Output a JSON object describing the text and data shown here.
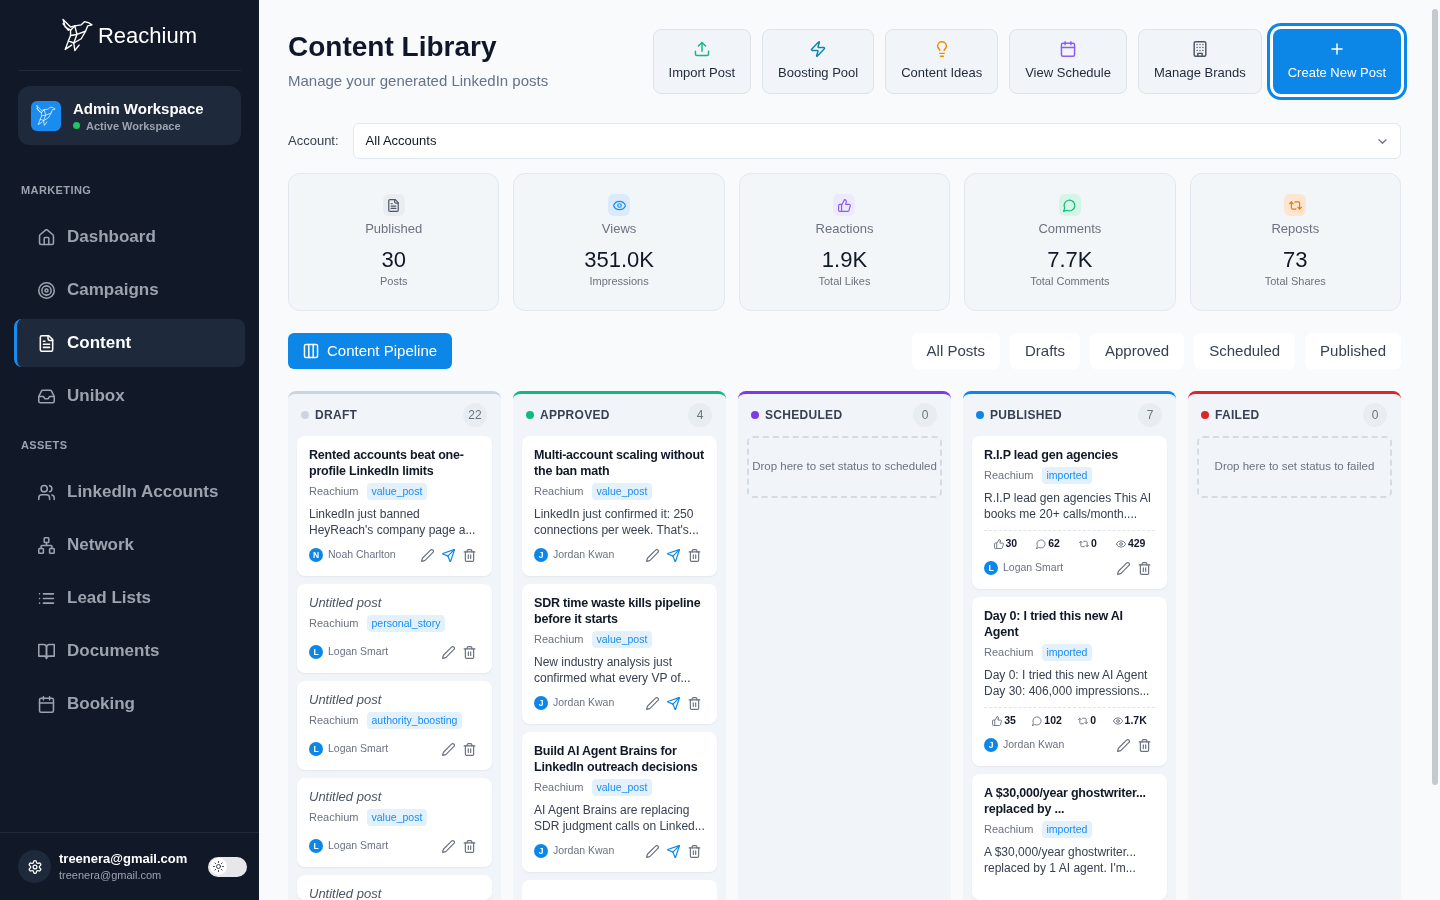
{
  "sidebar": {
    "brand": "Reachium",
    "workspace": {
      "name": "Admin Workspace",
      "status": "Active Workspace"
    },
    "sections": [
      {
        "title": "MARKETING",
        "items": [
          {
            "label": "Dashboard",
            "kind": "home",
            "selected": false
          },
          {
            "label": "Campaigns",
            "kind": "target",
            "selected": false
          },
          {
            "label": "Content",
            "kind": "document",
            "selected": true
          },
          {
            "label": "Unibox",
            "kind": "inbox",
            "selected": false
          }
        ]
      },
      {
        "title": "ASSETS",
        "items": [
          {
            "label": "LinkedIn Accounts",
            "kind": "users",
            "selected": false
          },
          {
            "label": "Network",
            "kind": "network",
            "selected": false
          },
          {
            "label": "Lead Lists",
            "kind": "list",
            "selected": false
          },
          {
            "label": "Documents",
            "kind": "book",
            "selected": false
          },
          {
            "label": "Booking",
            "kind": "calendar",
            "selected": false
          }
        ]
      }
    ],
    "user": {
      "name": "treenera@gmail.com",
      "email": "treenera@gmail.com"
    },
    "theme_toggle": {
      "dark_mode": false
    }
  },
  "header": {
    "title": "Content Library",
    "subtitle": "Manage your generated LinkedIn posts",
    "actions": [
      {
        "label": "Import Post",
        "kind": "upload",
        "primary": false
      },
      {
        "label": "Boosting Pool",
        "kind": "zap",
        "primary": false
      },
      {
        "label": "Content Ideas",
        "kind": "bulb",
        "primary": false
      },
      {
        "label": "View Schedule",
        "kind": "calendar",
        "primary": false
      },
      {
        "label": "Manage Brands",
        "kind": "building",
        "primary": false
      },
      {
        "label": "Create New Post",
        "kind": "plus",
        "primary": true
      }
    ]
  },
  "account_filter": {
    "label": "Account:",
    "value": "All Accounts"
  },
  "stats": [
    {
      "kind": "document",
      "label": "Published",
      "value": "30",
      "caption": "Posts"
    },
    {
      "kind": "eye",
      "label": "Views",
      "value": "351.0K",
      "caption": "Impressions"
    },
    {
      "kind": "thumb",
      "label": "Reactions",
      "value": "1.9K",
      "caption": "Total Likes"
    },
    {
      "kind": "comment",
      "label": "Comments",
      "value": "7.7K",
      "caption": "Total Comments"
    },
    {
      "kind": "repost",
      "label": "Reposts",
      "value": "73",
      "caption": "Total Shares"
    }
  ],
  "pipeline": {
    "view_button": "Content Pipeline",
    "filters": [
      "All Posts",
      "Drafts",
      "Approved",
      "Scheduled",
      "Published"
    ],
    "columns": [
      {
        "title": "DRAFT",
        "count": "22",
        "color": "#cbd5e1",
        "more_below": false,
        "cards": [
          {
            "title": "Rented accounts beat one-profile LinkedIn limits",
            "untitled": false,
            "brand": "Reachium",
            "tag": "value_post",
            "excerpt": "LinkedIn just banned HeyReach's company page a...",
            "author": {
              "initial": "N",
              "name": "Noah Charlton"
            },
            "actions": [
              {
                "kind": "edit"
              },
              {
                "kind": "send"
              },
              {
                "kind": "delete"
              }
            ]
          },
          {
            "title": "Untitled post",
            "untitled": true,
            "brand": "Reachium",
            "tag": "personal_story",
            "author": {
              "initial": "L",
              "name": "Logan Smart"
            },
            "actions": [
              {
                "kind": "edit"
              },
              {
                "kind": "delete"
              }
            ]
          },
          {
            "title": "Untitled post",
            "untitled": true,
            "brand": "Reachium",
            "tag": "authority_boosting",
            "author": {
              "initial": "L",
              "name": "Logan Smart"
            },
            "actions": [
              {
                "kind": "edit"
              },
              {
                "kind": "delete"
              }
            ]
          },
          {
            "title": "Untitled post",
            "untitled": true,
            "brand": "Reachium",
            "tag": "value_post",
            "author": {
              "initial": "L",
              "name": "Logan Smart"
            },
            "actions": [
              {
                "kind": "edit"
              },
              {
                "kind": "delete"
              }
            ]
          },
          {
            "title": "Untitled post",
            "untitled": true
          }
        ]
      },
      {
        "title": "APPROVED",
        "count": "4",
        "color": "#10b981",
        "more_below": true,
        "cards": [
          {
            "title": "Multi-account scaling without the ban math",
            "untitled": false,
            "brand": "Reachium",
            "tag": "value_post",
            "excerpt": "LinkedIn just confirmed it: 250 connections per week. That's...",
            "author": {
              "initial": "J",
              "name": "Jordan Kwan"
            },
            "actions": [
              {
                "kind": "edit"
              },
              {
                "kind": "send"
              },
              {
                "kind": "delete"
              }
            ]
          },
          {
            "title": "SDR time waste kills pipeline before it starts",
            "untitled": false,
            "brand": "Reachium",
            "tag": "value_post",
            "excerpt": "New industry analysis just confirmed what every VP of...",
            "author": {
              "initial": "J",
              "name": "Jordan Kwan"
            },
            "actions": [
              {
                "kind": "edit"
              },
              {
                "kind": "send"
              },
              {
                "kind": "delete"
              }
            ]
          },
          {
            "title": "Build AI Agent Brains for LinkedIn outreach decisions",
            "untitled": false,
            "brand": "Reachium",
            "tag": "value_post",
            "excerpt": "AI Agent Brains are replacing SDR judgment calls on Linked...",
            "author": {
              "initial": "J",
              "name": "Jordan Kwan"
            },
            "actions": [
              {
                "kind": "edit"
              },
              {
                "kind": "send"
              },
              {
                "kind": "delete"
              }
            ]
          }
        ]
      },
      {
        "title": "SCHEDULED",
        "count": "0",
        "color": "#7c3aed",
        "more_below": false,
        "drop_hint": "Drop here to set status to scheduled"
      },
      {
        "title": "PUBLISHED",
        "count": "7",
        "color": "#0c87e8",
        "more_below": false,
        "cards": [
          {
            "title": "R.I.P lead gen agencies",
            "untitled": false,
            "brand": "Reachium",
            "tag": "imported",
            "excerpt": "R.I.P lead gen agencies This AI books me 20+ calls/month....",
            "metrics": [
              {
                "kind": "thumb",
                "value": "30"
              },
              {
                "kind": "comment",
                "value": "62"
              },
              {
                "kind": "repost",
                "value": "0"
              },
              {
                "kind": "eye",
                "value": "429"
              }
            ],
            "author": {
              "initial": "L",
              "name": "Logan Smart"
            },
            "actions": [
              {
                "kind": "edit"
              },
              {
                "kind": "delete"
              }
            ]
          },
          {
            "title": "Day 0: I tried this new AI Agent",
            "untitled": false,
            "brand": "Reachium",
            "tag": "imported",
            "excerpt": "Day 0: I tried this new AI Agent Day 30: 406,000 impressions...",
            "metrics": [
              {
                "kind": "thumb",
                "value": "35"
              },
              {
                "kind": "comment",
                "value": "102"
              },
              {
                "kind": "repost",
                "value": "0"
              },
              {
                "kind": "eye",
                "value": "1.7K"
              }
            ],
            "author": {
              "initial": "J",
              "name": "Jordan Kwan"
            },
            "actions": [
              {
                "kind": "edit"
              },
              {
                "kind": "delete"
              }
            ]
          },
          {
            "title": "A $30,000/year ghostwriter... replaced by ...",
            "untitled": false,
            "brand": "Reachium",
            "tag": "imported",
            "excerpt": "A $30,000/year ghostwriter... replaced by 1 AI agent. I'm..."
          }
        ]
      },
      {
        "title": "FAILED",
        "count": "0",
        "color": "#dc2626",
        "more_below": false,
        "drop_hint": "Drop here to set status to failed"
      }
    ]
  }
}
